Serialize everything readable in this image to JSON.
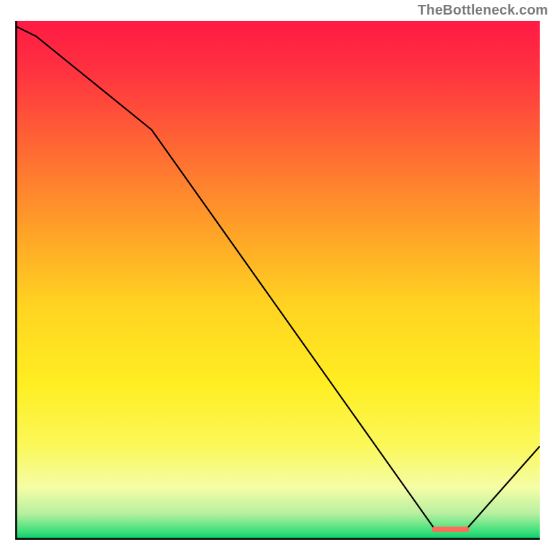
{
  "attribution": "TheBottleneck.com",
  "chart_data": {
    "type": "line",
    "title": "",
    "xlabel": "",
    "ylabel": "",
    "xlim": [
      0,
      100
    ],
    "ylim": [
      0,
      100
    ],
    "series": [
      {
        "name": "curve",
        "x": [
          0,
          4,
          26,
          80,
          86,
          100
        ],
        "values": [
          99,
          97,
          79,
          2,
          2,
          18
        ]
      }
    ],
    "optimal_zone": {
      "x_start": 80,
      "x_end": 86,
      "y": 2
    },
    "background_gradient": {
      "stops": [
        {
          "t": 0.0,
          "color": "#ff1a44"
        },
        {
          "t": 0.1,
          "color": "#ff3340"
        },
        {
          "t": 0.25,
          "color": "#ff6a33"
        },
        {
          "t": 0.4,
          "color": "#ffa028"
        },
        {
          "t": 0.55,
          "color": "#ffd421"
        },
        {
          "t": 0.7,
          "color": "#ffee22"
        },
        {
          "t": 0.82,
          "color": "#fbf85a"
        },
        {
          "t": 0.9,
          "color": "#f5fda6"
        },
        {
          "t": 0.95,
          "color": "#b6f0a0"
        },
        {
          "t": 0.985,
          "color": "#3adf7a"
        },
        {
          "t": 1.0,
          "color": "#05c968"
        }
      ]
    },
    "axis_color": "#000000",
    "line_color": "#000000",
    "marker_color": "#ff6a5a"
  }
}
